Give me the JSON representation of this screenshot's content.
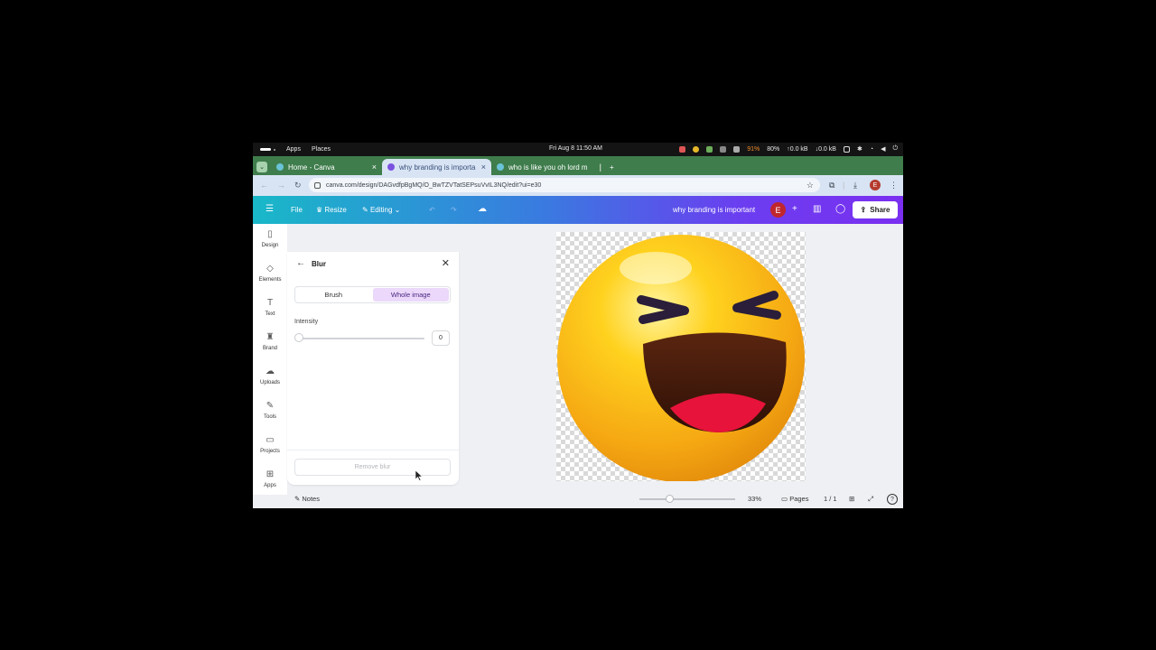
{
  "system_bar": {
    "apps_label": "Apps",
    "places_label": "Places",
    "clock": "Fri Aug 8  11:50 AM",
    "battery": "91%",
    "volume": "80%",
    "net_up": "↑0.0 kB",
    "net_down": "↓0.0 kB"
  },
  "tabs": [
    {
      "title": "Home - Canva",
      "active": false,
      "close": "×"
    },
    {
      "title": "why branding is importa",
      "active": true,
      "close": "×"
    },
    {
      "title": "who is like you oh lord m",
      "active": false,
      "close": "|"
    }
  ],
  "new_tab": "+",
  "window_controls": {
    "minimize": "–",
    "restore": "⧉",
    "close": "✕"
  },
  "address_bar": {
    "url": "canva.com/design/DAGvdfpBgMQ/O_BwTZVTatSEPsuVvIL3NQ/edit?ui=e30",
    "avatar_initial": "E"
  },
  "canva_header": {
    "menu_icon": "hamburger-icon",
    "file": "File",
    "resize": "Resize",
    "editing": "Editing",
    "design_title": "why branding is important",
    "avatar_initial": "E",
    "plus": "+",
    "share": "Share",
    "accent_color": "#7a2ff0"
  },
  "sidebar": {
    "items": [
      {
        "label": "Design",
        "icon": "design-icon"
      },
      {
        "label": "Elements",
        "icon": "elements-icon"
      },
      {
        "label": "Text",
        "icon": "text-icon"
      },
      {
        "label": "Brand",
        "icon": "brand-icon"
      },
      {
        "label": "Uploads",
        "icon": "uploads-icon"
      },
      {
        "label": "Tools",
        "icon": "tools-icon"
      },
      {
        "label": "Projects",
        "icon": "projects-icon"
      },
      {
        "label": "Apps",
        "icon": "apps-icon"
      }
    ]
  },
  "blur_panel": {
    "title": "Blur",
    "modes": [
      "Brush",
      "Whole image"
    ],
    "selected_mode": "Whole image",
    "intensity_label": "Intensity",
    "intensity_value": "0",
    "remove_button": "Remove blur"
  },
  "canvas": {
    "image": "laughing-emoji"
  },
  "bottom_bar": {
    "notes": "Notes",
    "zoom": "33%",
    "pages": "Pages",
    "page_count": "1 / 1",
    "help": "?"
  }
}
